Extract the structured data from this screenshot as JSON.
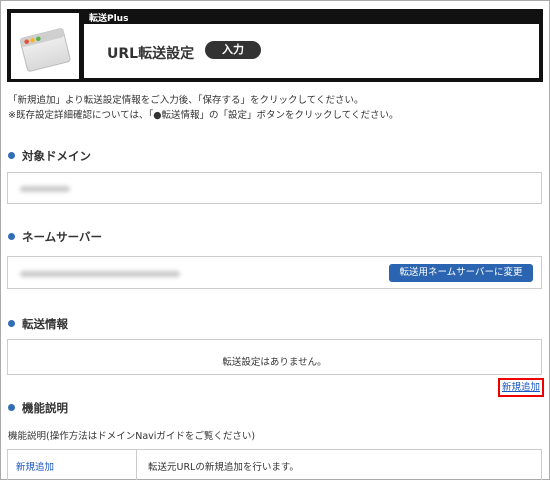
{
  "header": {
    "brand": "転送Plus",
    "page_title": "URL転送設定",
    "step_badge": "入力"
  },
  "instructions": {
    "line1": "「新規追加」より転送設定情報をご入力後、「保存する」をクリックしてください。",
    "line2": "※既存設定詳細確認については、「●転送情報」の「設定」ボタンをクリックしてください。"
  },
  "sections": {
    "domain": {
      "title": "対象ドメイン"
    },
    "nameserver": {
      "title": "ネームサーバー",
      "button_label": "転送用ネームサーバーに変更"
    },
    "transfer": {
      "title": "転送情報",
      "empty_message": "転送設定はありません。",
      "add_link": "新規追加"
    },
    "function": {
      "title": "機能説明",
      "caption": "機能説明(操作方法はドメインNaviガイドをご覧ください)",
      "rows": [
        {
          "name": "新規追加",
          "description": "転送元URLの新規追加を行います。"
        }
      ]
    }
  },
  "colors": {
    "header_bg": "#111111",
    "accent_blue": "#2b64b0",
    "link_blue": "#1a56c4",
    "highlight_red": "#ee0000"
  }
}
